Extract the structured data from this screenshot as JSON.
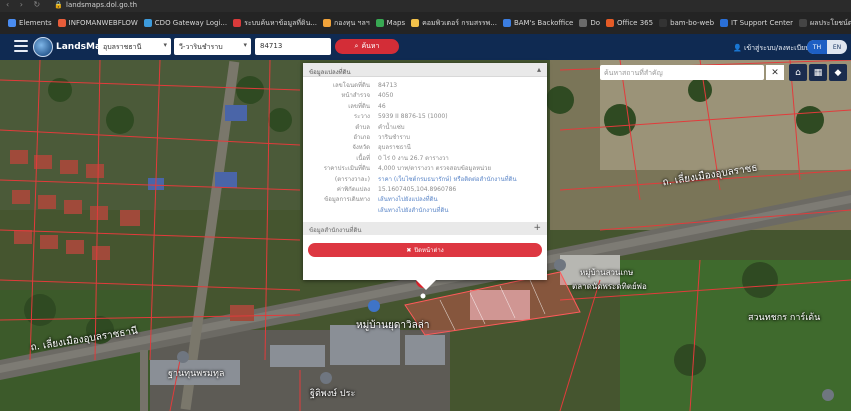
{
  "browser": {
    "url": "landsmaps.dol.go.th",
    "bookmarks": [
      {
        "label": "Elements",
        "color": "#4a8cf0"
      },
      {
        "label": "INFOMANWEBFLOW",
        "color": "#e85d3a"
      },
      {
        "label": "CDO Gateway Logi...",
        "color": "#3d9bdc"
      },
      {
        "label": "ระบบค้นหาข้อมูลที่ดิน...",
        "color": "#d93a3a"
      },
      {
        "label": "กองทุน ฯลฯ",
        "color": "#f1a33a"
      },
      {
        "label": "Maps",
        "color": "#38a853"
      },
      {
        "label": "คอมพิวเตอร์ กรมสรรพ...",
        "color": "#f2c14a"
      },
      {
        "label": "BAM's Backoffice",
        "color": "#3b7de0"
      },
      {
        "label": "Do",
        "color": "#6b6b6b"
      },
      {
        "label": "Office 365",
        "color": "#e55b26"
      },
      {
        "label": "bam-bo-web",
        "color": "#333333"
      },
      {
        "label": "IT Support Center",
        "color": "#2a6fd6"
      },
      {
        "label": "ผลประโยชน์ต่อเนื่อง",
        "color": "#444444"
      }
    ]
  },
  "header": {
    "brand": "LandsMaps",
    "province": "อุบลราชธานี",
    "district": "วี-วารินชำราบ",
    "parcel_no": "84713",
    "search_label": "ค้นหา",
    "login_label": "เข้าสู่ระบบ/ลงทะเบียน",
    "lang_th": "TH",
    "lang_en": "EN"
  },
  "map_search": {
    "placeholder": "ค้นหาสถานที่สำคัญ",
    "clear_label": "✕"
  },
  "map_labels": {
    "road_upper_right": "ถ. เลี่ยงเมืองอุบลราชธ",
    "road_lower_left": "ถ. เลี่ยงเมืองอุบลราชธานี",
    "village": "หมู่บ้านยุดาวิลล่า",
    "market": "ตลาดนัดพระดทิตย์พ่อ",
    "poi_upper": "หมู่บ้านสวนเกษ",
    "garden": "สวนทชกร การ์เด้น",
    "bottom_left": "ฐานทุนพรมทุล",
    "bottom_mid": "ฐิติพงษ์ ประ"
  },
  "popup": {
    "header": "ข้อมูลแปลงที่ดิน",
    "rows": [
      {
        "key": "เลขโฉนดที่ดิน",
        "value": "84713"
      },
      {
        "key": "หน้าสำรวจ",
        "value": "4050"
      },
      {
        "key": "เลขที่ดิน",
        "value": "46"
      },
      {
        "key": "ระวาง",
        "value": "5939 II 8876-15 (1000)"
      },
      {
        "key": "ตำบล",
        "value": "คำน้ำแซ่บ"
      },
      {
        "key": "อำเภอ",
        "value": "วารินชำราบ"
      },
      {
        "key": "จังหวัด",
        "value": "อุบลราชธานี"
      },
      {
        "key": "เนื้อที่",
        "value": "0 ไร่ 0 งาน 26.7 ตารางวา"
      },
      {
        "key": "ราคาประเมินที่ดิน",
        "value": "4,000 บาท/ตารางวา ตรวจสอบข้อมูลหน่วย"
      },
      {
        "key": "(ตารางวาละ)",
        "value": "ราคา (เว็บไซต์กรมธนารักษ์) หรือติดต่อสำนักงานที่ดิน"
      },
      {
        "key": "ค่าพิกัดแปลง",
        "value": "15.1607405,104.8960786"
      },
      {
        "key": "ข้อมูลการเดินทาง",
        "value": "เส้นทางไปยังแปลงที่ดิน"
      },
      {
        "key": "",
        "value": "เส้นทางไปยังสำนักงานที่ดิน"
      }
    ],
    "sub_header": "ข้อมูลสำนักงานที่ดิน",
    "close_label": "ปิดหน้าต่าง"
  }
}
